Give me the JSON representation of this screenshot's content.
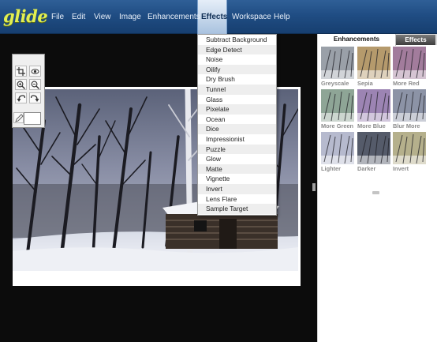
{
  "app": {
    "logo_text": "glide",
    "brand_color": "#e2ef52"
  },
  "menu": {
    "items": [
      "File",
      "Edit",
      "View",
      "Image",
      "Enhancements",
      "Effects",
      "Workspace",
      "Help"
    ],
    "active": "Effects"
  },
  "effects_menu": {
    "items": [
      "Subtract Background",
      "Edge Detect",
      "Noise",
      "Oilify",
      "Dry Brush",
      "Tunnel",
      "Glass",
      "Pixelate",
      "Ocean",
      "Dice",
      "Impressionist",
      "Puzzle",
      "Glow",
      "Matte",
      "Vignette",
      "Invert",
      "Lens Flare",
      "Sample Target"
    ]
  },
  "tools": {
    "icons": [
      "crop-icon",
      "eye-icon",
      "zoom-in-icon",
      "zoom-out-icon",
      "undo-icon",
      "redo-icon",
      "pencil-icon"
    ]
  },
  "panel": {
    "tabs": [
      "Enhancements",
      "Effects"
    ],
    "active_tab": "Enhancements",
    "thumbnails": [
      {
        "label": "Greyscale",
        "tint": "#9aa0a8"
      },
      {
        "label": "Sepia",
        "tint": "#b59a6c"
      },
      {
        "label": "More Red",
        "tint": "#a27c9c"
      },
      {
        "label": "More Green",
        "tint": "#8ea596"
      },
      {
        "label": "More Blue",
        "tint": "#9c84b3"
      },
      {
        "label": "Blur More",
        "tint": "#8c93a6"
      },
      {
        "label": "Lighter",
        "tint": "#b6bace"
      },
      {
        "label": "Darker",
        "tint": "#555b6a"
      },
      {
        "label": "Invert",
        "tint": "#b5b08c"
      }
    ]
  }
}
